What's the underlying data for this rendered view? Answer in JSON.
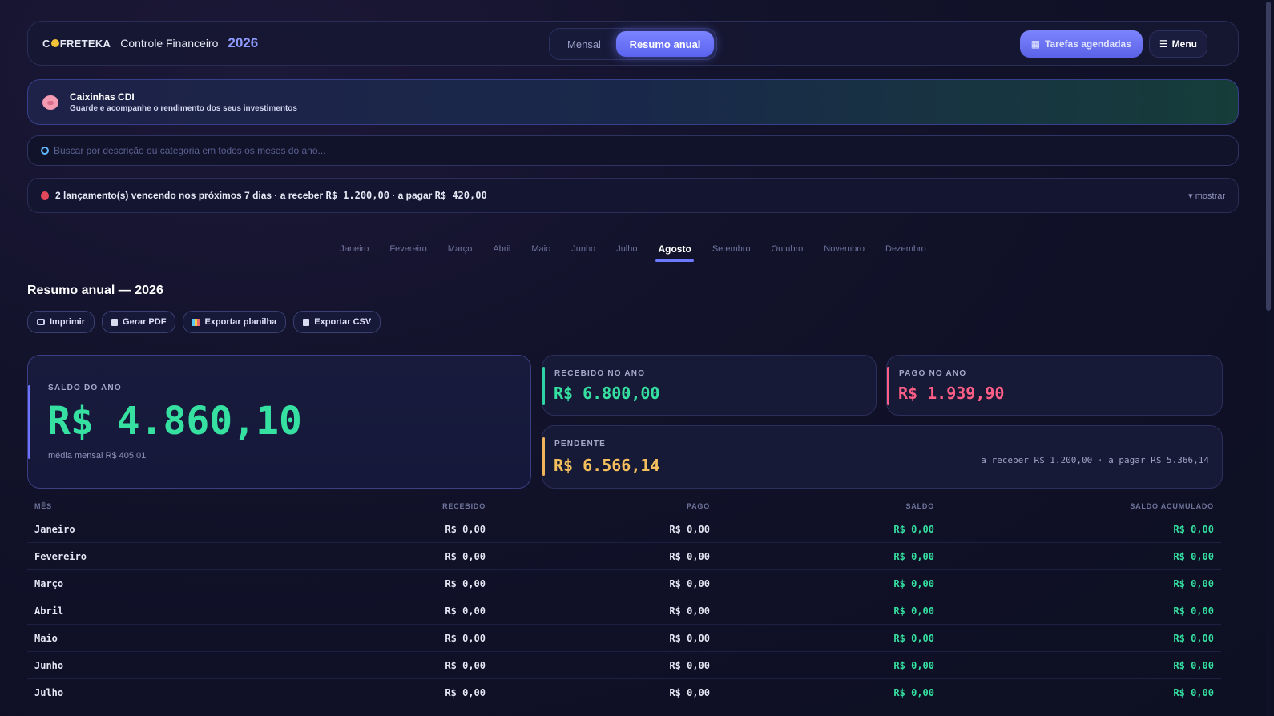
{
  "header": {
    "logo_prefix": "C",
    "logo_suffix": "FRETEKA",
    "app_title": "Controle Financeiro",
    "year": "2026",
    "view_toggle": {
      "mensal": "Mensal",
      "anual": "Resumo anual",
      "selected": "anual"
    },
    "tasks_button": "Tarefas agendadas",
    "menu_button": "Menu"
  },
  "banner": {
    "icon": "piggy-bank-icon",
    "title": "Caixinhas CDI",
    "subtitle": "Guarde e acompanhe o rendimento dos seus investimentos"
  },
  "search": {
    "placeholder": "Buscar por descrição ou categoria em todos os meses do ano...",
    "value": ""
  },
  "alert": {
    "icon": "alarm-clock-icon",
    "text_prefix": "2 lançamento(s) vencendo nos próximos 7 dias · a receber",
    "receive": "R$ 1.200,00",
    "text_mid": "· a pagar",
    "pay": "R$ 420,00",
    "toggle": "▾ mostrar"
  },
  "months": {
    "items": [
      "Janeiro",
      "Fevereiro",
      "Março",
      "Abril",
      "Maio",
      "Junho",
      "Julho",
      "Agosto",
      "Setembro",
      "Outubro",
      "Novembro",
      "Dezembro"
    ],
    "selected": "Agosto"
  },
  "summary": {
    "title": "Resumo anual — 2026",
    "actions": {
      "print": "Imprimir",
      "pdf": "Gerar PDF",
      "sheet": "Exportar planilha",
      "csv": "Exportar CSV"
    },
    "saldo": {
      "label": "SALDO DO ANO",
      "value": "R$ 4.860,10",
      "media": "média mensal R$ 405,01"
    },
    "recebido": {
      "label": "RECEBIDO NO ANO",
      "value": "R$ 6.800,00"
    },
    "pago": {
      "label": "PAGO NO ANO",
      "value": "R$ 1.939,90"
    },
    "pendente": {
      "label": "PENDENTE",
      "value": "R$ 6.566,14",
      "detail": "a receber R$ 1.200,00 · a pagar R$ 5.366,14"
    }
  },
  "colors": {
    "accent": "#6d7aff",
    "positive": "#35e0a1",
    "negative": "#ff5f87",
    "pending": "#f4bf5c"
  },
  "table": {
    "headers": {
      "mes": "MÊS",
      "recebido": "RECEBIDO",
      "pago": "PAGO",
      "saldo": "SALDO",
      "acumulado": "SALDO ACUMULADO"
    },
    "rows": [
      {
        "mes": "Janeiro",
        "recebido": "R$ 0,00",
        "pago": "R$ 0,00",
        "saldo": "R$ 0,00",
        "acumulado": "R$ 0,00"
      },
      {
        "mes": "Fevereiro",
        "recebido": "R$ 0,00",
        "pago": "R$ 0,00",
        "saldo": "R$ 0,00",
        "acumulado": "R$ 0,00"
      },
      {
        "mes": "Março",
        "recebido": "R$ 0,00",
        "pago": "R$ 0,00",
        "saldo": "R$ 0,00",
        "acumulado": "R$ 0,00"
      },
      {
        "mes": "Abril",
        "recebido": "R$ 0,00",
        "pago": "R$ 0,00",
        "saldo": "R$ 0,00",
        "acumulado": "R$ 0,00"
      },
      {
        "mes": "Maio",
        "recebido": "R$ 0,00",
        "pago": "R$ 0,00",
        "saldo": "R$ 0,00",
        "acumulado": "R$ 0,00"
      },
      {
        "mes": "Junho",
        "recebido": "R$ 0,00",
        "pago": "R$ 0,00",
        "saldo": "R$ 0,00",
        "acumulado": "R$ 0,00"
      },
      {
        "mes": "Julho",
        "recebido": "R$ 0,00",
        "pago": "R$ 0,00",
        "saldo": "R$ 0,00",
        "acumulado": "R$ 0,00"
      }
    ]
  }
}
